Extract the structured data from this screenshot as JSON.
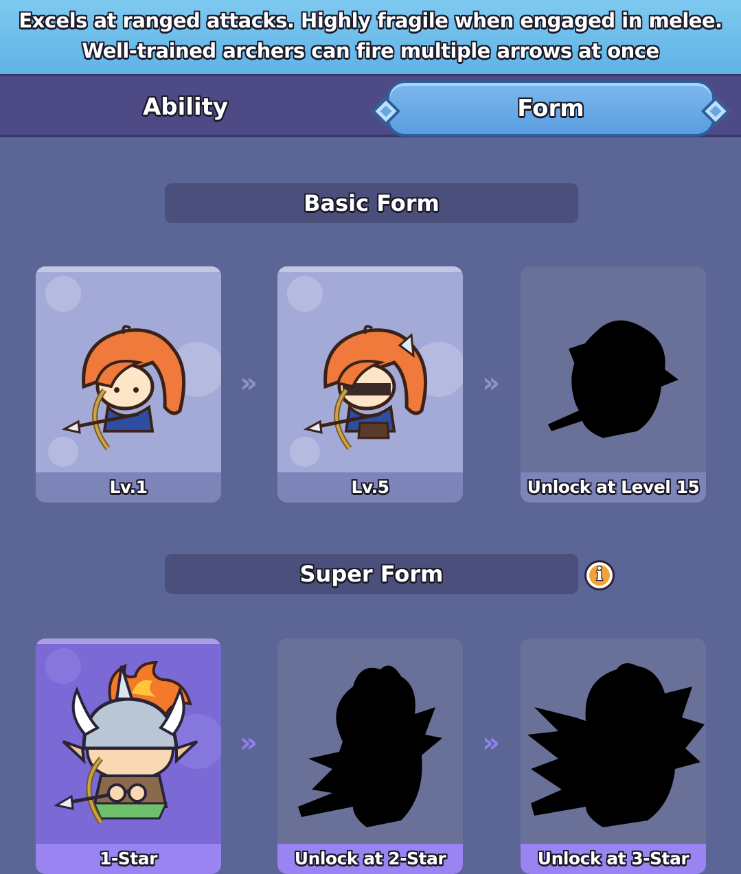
{
  "description": {
    "line1": "Excels at ranged attacks. Highly fragile when engaged in melee.",
    "line2": "Well-trained archers can fire multiple arrows at once"
  },
  "tabs": {
    "ability_label": "Ability",
    "form_label": "Form",
    "active": "Form"
  },
  "basic_form": {
    "title": "Basic Form",
    "cards": [
      {
        "label": "Lv.1",
        "state": "unlocked",
        "icon": "archer-lv1-portrait"
      },
      {
        "label": "Lv.5",
        "state": "unlocked",
        "icon": "archer-lv5-portrait"
      },
      {
        "label": "Unlock at Level 15",
        "state": "locked",
        "icon": "silhouette-icon"
      }
    ]
  },
  "super_form": {
    "title": "Super Form",
    "info_icon": "info-icon",
    "cards": [
      {
        "label": "1-Star",
        "state": "unlocked",
        "icon": "archer-1star-portrait"
      },
      {
        "label": "Unlock at 2-Star",
        "state": "locked",
        "icon": "silhouette-icon"
      },
      {
        "label": "Unlock at 3-Star",
        "state": "locked",
        "icon": "silhouette-icon"
      }
    ]
  },
  "colors": {
    "background": "#5c6696",
    "banner": "#6fbeeb",
    "tab_active": "#6aa8e6",
    "super_accent": "#9a84f2",
    "info_orange": "#f4a234"
  }
}
